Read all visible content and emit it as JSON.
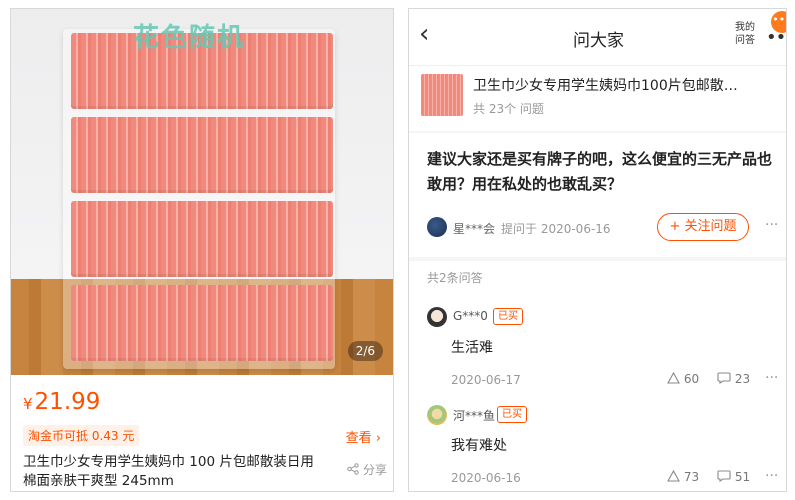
{
  "left": {
    "watermark": "花色随机",
    "image_counter": "2/6",
    "price_currency": "¥",
    "price_value": "21.99",
    "coupon": "淘金币可抵 0.43 元",
    "view_more": "查看 ›",
    "title": "卫生巾少女专用学生姨妈巾 100 片包邮散装日用棉面亲肤干爽型 245mm",
    "share": "分享"
  },
  "right": {
    "nav": {
      "back": "‹",
      "title": "问大家",
      "my_questions": "我的问答",
      "more": "•••"
    },
    "product": {
      "title": "卫生巾少女专用学生姨妈巾100片包邮散…",
      "count": "共 23个 问题"
    },
    "question": {
      "text": "建议大家还是买有牌子的吧，这么便宜的三无产品也敢用？用在私处的也敢乱买？",
      "asker": "星***会",
      "asked_at": "提问于 2020-06-16",
      "follow": "+ 关注问题",
      "more": "···"
    },
    "answers_count": "共2条问答",
    "answers": [
      {
        "name": "G***0",
        "bought": "已买",
        "text": "生活难",
        "date": "2020-06-17",
        "likes": "60",
        "comments": "23"
      },
      {
        "name": "河***鱼",
        "bought": "已买",
        "text": "我有难处",
        "date": "2020-06-16",
        "likes": "73",
        "comments": "51"
      }
    ]
  },
  "colors": {
    "accent": "#ff5000",
    "watermark": "#66c8b5",
    "pad_pink": "#f08a7e"
  }
}
